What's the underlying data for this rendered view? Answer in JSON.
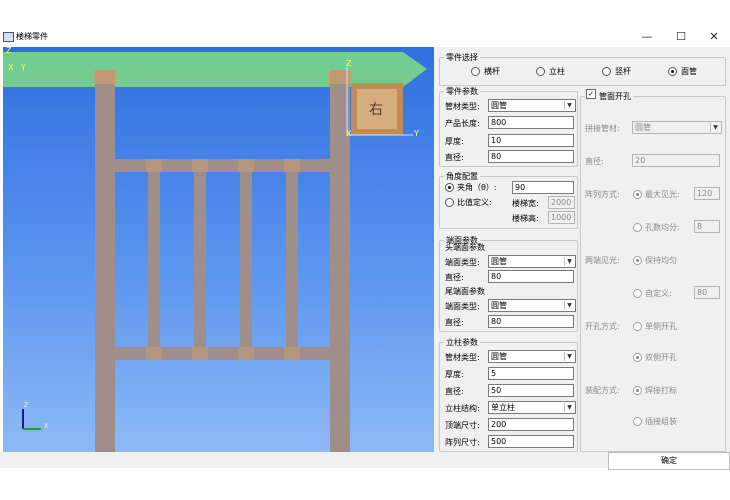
{
  "window": {
    "title": "楼梯零件",
    "minimize": "—",
    "maximize": "☐",
    "close": "✕"
  },
  "viewport": {
    "axis_top_left": [
      "Z",
      "X",
      "Y"
    ],
    "cube_axis": {
      "z": "Z",
      "x": "X",
      "y": "Y"
    },
    "view_cube_face": "右",
    "triad": {
      "z": "Z",
      "x": "X"
    }
  },
  "part_select": {
    "title": "零件选择",
    "options": [
      "横杆",
      "立柱",
      "竖杆",
      "面管"
    ],
    "selected": "面管"
  },
  "part_params": {
    "title": "零件参数",
    "pipe_type_label": "管材类型:",
    "pipe_type_value": "圆管",
    "length_label": "产品长度:",
    "length_value": "800",
    "thickness_label": "厚度:",
    "thickness_value": "10",
    "diameter_label": "直径:",
    "diameter_value": "80"
  },
  "angle": {
    "title": "角度配置",
    "angle_option": "夹角（θ）:",
    "angle_value": "90",
    "ratio_option": "比值定义:",
    "stair_width_label": "楼梯宽:",
    "stair_width_value": "2000",
    "stair_height_label": "楼梯高:",
    "stair_height_value": "1000",
    "selected": "angle"
  },
  "end_params": {
    "title": "端面参数",
    "head_title": "头端面参数",
    "head_type_label": "端面类型:",
    "head_type_value": "圆管",
    "head_diameter_label": "直径:",
    "head_diameter_value": "80",
    "tail_title": "尾端面参数",
    "tail_type_label": "端面类型:",
    "tail_type_value": "圆管",
    "tail_diameter_label": "直径:",
    "tail_diameter_value": "80"
  },
  "post_params": {
    "title": "立柱参数",
    "pipe_type_label": "管材类型:",
    "pipe_type_value": "圆管",
    "thickness_label": "厚度:",
    "thickness_value": "5",
    "diameter_label": "直径:",
    "diameter_value": "50",
    "structure_label": "立柱结构:",
    "structure_value": "单立柱",
    "top_size_label": "顶端尺寸:",
    "top_size_value": "200",
    "array_size_label": "阵列尺寸:",
    "array_size_value": "500"
  },
  "face_hole": {
    "title": "管面开孔",
    "checked": true,
    "check_mark": "✓",
    "splice_label": "拼接管材:",
    "splice_value": "圆管",
    "diameter_label": "直径:",
    "diameter_value": "20",
    "array_mode_label": "阵列方式:",
    "max_gap_label": "最大见光:",
    "max_gap_value": "120",
    "hole_count_label": "孔数均分:",
    "hole_count_value": "8",
    "end_gap_label": "两端见光:",
    "keep_equal_label": "保持均匀",
    "custom_label": "自定义:",
    "custom_value": "80",
    "hole_mode_label": "开孔方式:",
    "single_side_label": "单侧开孔",
    "double_side_label": "双侧开孔",
    "assembly_label": "装配方式:",
    "weld_label": "焊接打标",
    "plug_label": "插接组装"
  },
  "ok_label": "确定",
  "colors": {
    "viewport_top": "#2f6fe0",
    "viewport_bottom": "#8dbaf6",
    "pipe": "#a08e8a",
    "arrow": "#7fdc82"
  }
}
